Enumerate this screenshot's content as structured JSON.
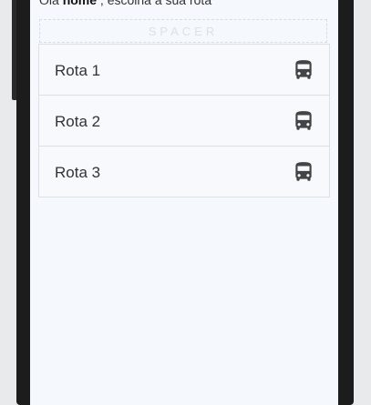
{
  "header": {
    "greeting_prefix": "Olá ",
    "user_name": "nome",
    "greeting_suffix": " , escolha a sua rota"
  },
  "spacer": {
    "label": "SPACER"
  },
  "routes": [
    {
      "label": "Rota 1",
      "icon": "bus-icon"
    },
    {
      "label": "Rota 2",
      "icon": "bus-icon"
    },
    {
      "label": "Rota 3",
      "icon": "bus-icon"
    }
  ],
  "colors": {
    "screen_background": "#f5f8fd",
    "bezel": "#1c1c1d",
    "icon": "#444444",
    "divider": "#dde1e6"
  }
}
